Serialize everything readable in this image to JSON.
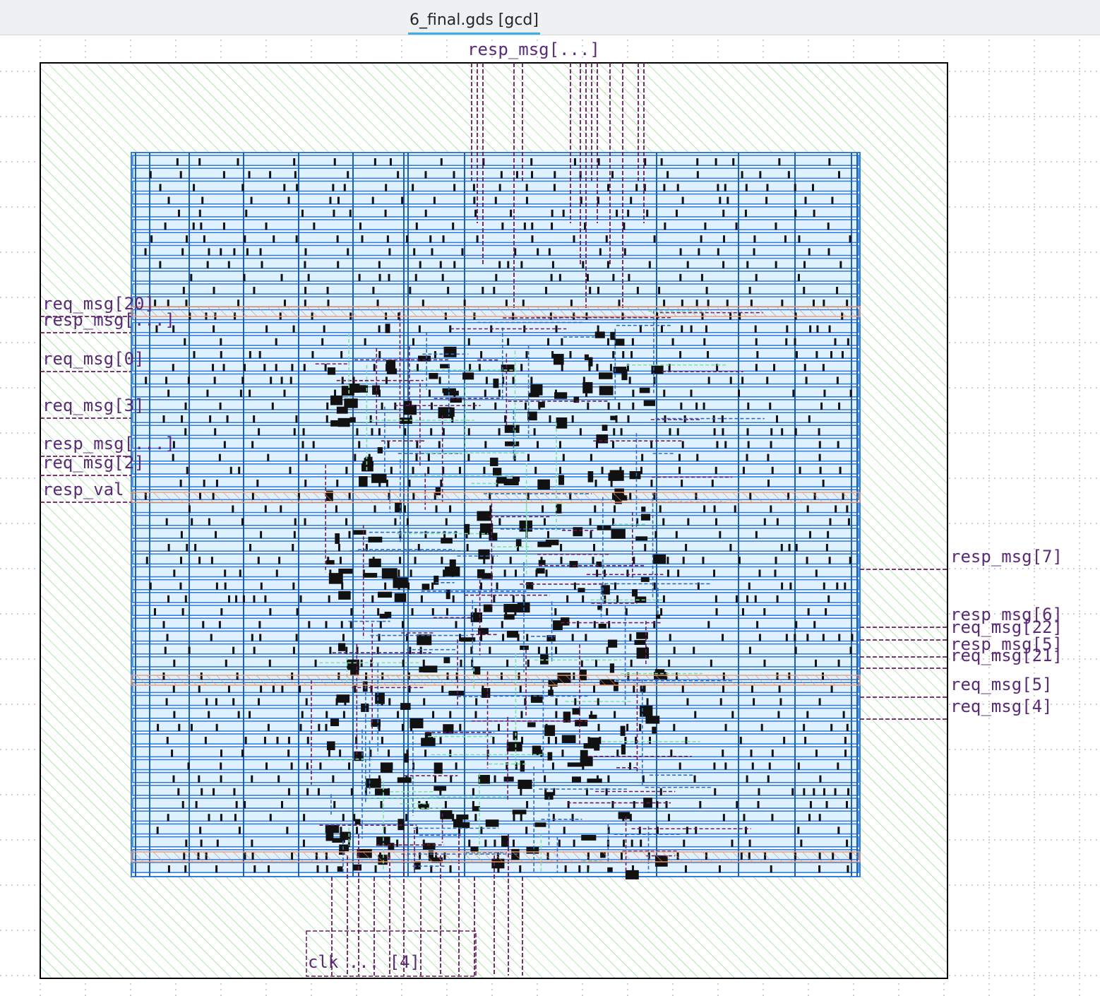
{
  "window": {
    "tab_title": "6_final.gds [gcd]"
  },
  "layout_view": {
    "colors": {
      "background": "#ffffff",
      "grid": "#9aa0a6",
      "die_fill": "#b9ecb6",
      "die_border": "#000000",
      "core_metal": "#2f7fe0",
      "row_fill": "#dff0ff",
      "cell_metal": "#111111",
      "route": "#6b1a5e",
      "power_stripe": "#ef9a6a",
      "pin_label": "#5a2a78"
    },
    "pins_left": [
      "req_msg[20]",
      "resp_msg[...]",
      "req_msg[0]",
      "req_msg[3]",
      "resp_msg[...]",
      "req_msg[2]",
      "resp_val"
    ],
    "pins_right": [
      "resp_msg[7]",
      "resp_msg[6]",
      "req_msg[22]",
      "resp_msg[5]",
      "req_msg[21]",
      "req_msg[5]",
      "req_msg[4]"
    ],
    "pins_top_label": "resp_msg[...]",
    "pins_bottom_label": "clk ... [4]"
  }
}
